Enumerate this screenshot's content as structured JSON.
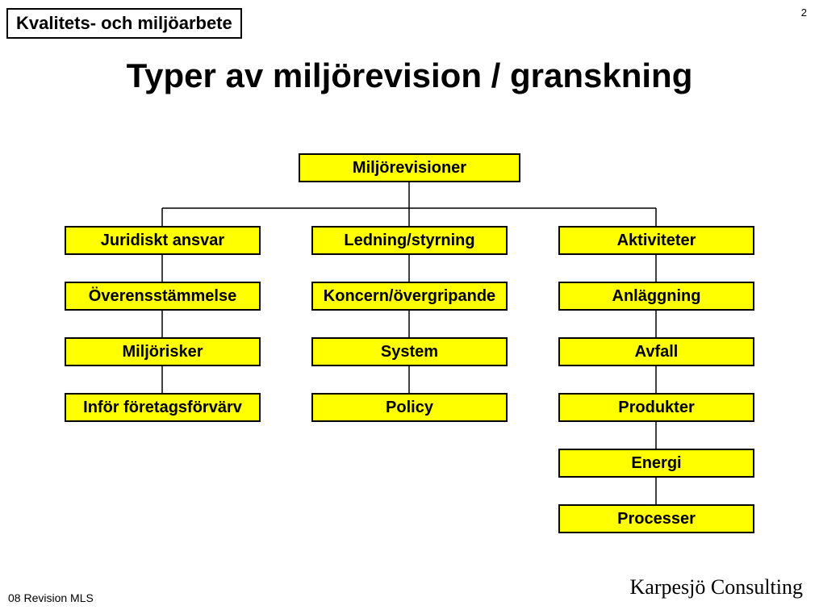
{
  "header": "Kvalitets- och miljöarbete",
  "page_number": "2",
  "title": "Typer av miljörevision / granskning",
  "root": "Miljörevisioner",
  "columns": {
    "col1": [
      "Juridiskt ansvar",
      "Överensstämmelse",
      "Miljörisker",
      "Inför företagsförvärv"
    ],
    "col2": [
      "Ledning/styrning",
      "Koncern/övergripande",
      "System",
      "Policy"
    ],
    "col3": [
      "Aktiviteter",
      "Anläggning",
      "Avfall",
      "Produkter",
      "Energi",
      "Processer"
    ]
  },
  "footer_left": "08 Revision MLS",
  "footer_right": "Karpesjö Consulting"
}
